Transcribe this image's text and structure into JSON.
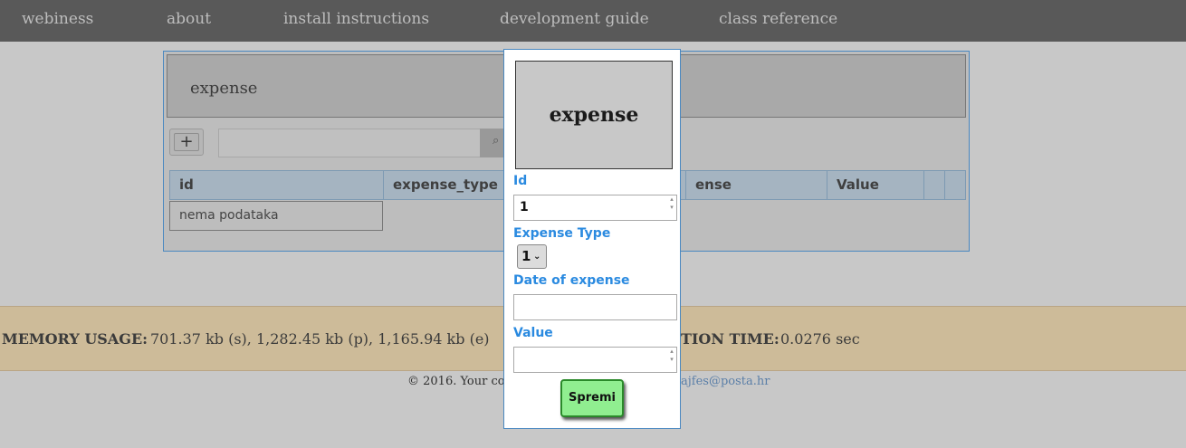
{
  "nav": {
    "items": [
      {
        "label": "webiness"
      },
      {
        "label": "about"
      },
      {
        "label": "install instructions"
      },
      {
        "label": "development guide"
      },
      {
        "label": "class reference"
      }
    ]
  },
  "panel": {
    "title": "expense",
    "add_label": "+",
    "search_placeholder": "",
    "search_icon": "⌕",
    "columns": [
      "id",
      "expense_type",
      "ense",
      "Value",
      "",
      ""
    ],
    "empty_text": "nema podataka"
  },
  "memory": {
    "usage_label": "MEMORY USAGE:",
    "usage_value": "701.37 kb (s), 1,282.45 kb (p), 1,165.94 kb (e)",
    "time_label": "TION TIME:",
    "time_value": "0.0276 sec"
  },
  "footer": {
    "copyright": "© 2016. Your co",
    "email": "ajfes@posta.hr"
  },
  "modal": {
    "image_text": "expense",
    "id_label": "Id",
    "id_value": "1",
    "type_label": "Expense Type",
    "type_value": "1",
    "date_label": "Date of expense",
    "date_value": "",
    "value_label": "Value",
    "value_value": "",
    "save_label": "Spremi"
  }
}
